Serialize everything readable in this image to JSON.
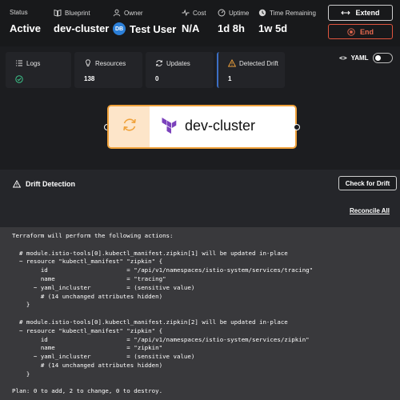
{
  "header": {
    "status": {
      "label": "Status",
      "value": "Active"
    },
    "blueprint": {
      "label": "Blueprint",
      "value": "dev-cluster",
      "icon": "book-icon"
    },
    "owner": {
      "label": "Owner",
      "value": "Test User",
      "avatar_initials": "DB",
      "icon": "user-icon"
    },
    "cost": {
      "label": "Cost",
      "value": "N/A",
      "icon": "pulse-icon"
    },
    "uptime": {
      "label": "Uptime",
      "value": "1d 8h",
      "icon": "gauge-icon"
    },
    "time_remaining": {
      "label": "Time Remaining",
      "value": "1w 5d",
      "icon": "clock-icon"
    },
    "extend_label": "Extend",
    "end_label": "End"
  },
  "tabs": [
    {
      "label": "Logs",
      "value": "",
      "icon": "list-icon"
    },
    {
      "label": "Resources",
      "value": "138",
      "icon": "bulb-icon"
    },
    {
      "label": "Updates",
      "value": "0",
      "icon": "refresh-icon"
    },
    {
      "label": "Detected Drift",
      "value": "1",
      "icon": "warning-icon"
    }
  ],
  "yaml_label": "YAML",
  "node": {
    "title": "dev-cluster"
  },
  "drift": {
    "title": "Drift Detection",
    "check_label": "Check for Drift",
    "reconcile_label": "Reconcile All",
    "code_lines": [
      "Terraform will perform the following actions:",
      "",
      "  # module.istio-tools[0].kubectl_manifest.zipkin[1] will be updated in-place",
      "  ~ resource \"kubectl_manifest\" \"zipkin\" {",
      "        id                      = \"/api/v1/namespaces/istio-system/services/tracing\"",
      "        name                    = \"tracing\"",
      "      ~ yaml_incluster          = (sensitive value)",
      "        # (14 unchanged attributes hidden)",
      "    }",
      "",
      "  # module.istio-tools[0].kubectl_manifest.zipkin[2] will be updated in-place",
      "  ~ resource \"kubectl_manifest\" \"zipkin\" {",
      "        id                      = \"/api/v1/namespaces/istio-system/services/zipkin\"",
      "        name                    = \"zipkin\"",
      "      ~ yaml_incluster          = (sensitive value)",
      "        # (14 unchanged attributes hidden)",
      "    }",
      "",
      "Plan: 0 to add, 2 to change, 0 to destroy."
    ]
  },
  "colors": {
    "accent": "#f0a23b",
    "danger": "#e0553e",
    "success": "#3cc48a",
    "active_tab": "#3c6fc4",
    "terraform": "#7b42bc"
  }
}
